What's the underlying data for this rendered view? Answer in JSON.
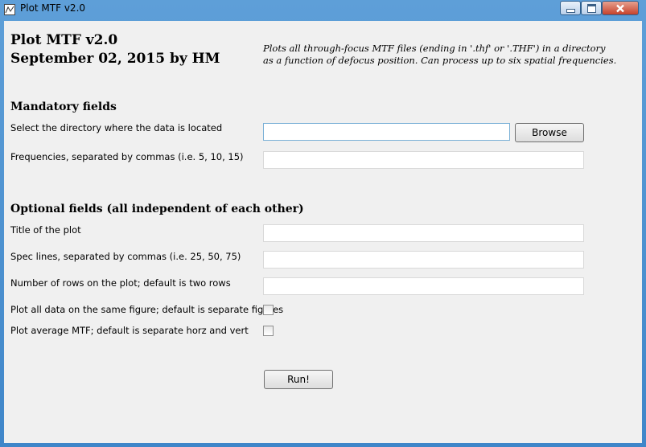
{
  "window": {
    "title": "Plot MTF v2.0"
  },
  "header": {
    "title_line1": "Plot MTF v2.0",
    "title_line2": "September 02, 2015 by HM",
    "desc_line1": "Plots all through-focus MTF files (ending in '.thf' or '.THF') in a directory",
    "desc_line2": "as a function of defocus position.  Can process up to six spatial frequencies."
  },
  "mandatory": {
    "heading": "Mandatory fields",
    "directory_label": "Select the directory where the data is located",
    "directory_value": "",
    "browse_label": "Browse",
    "frequencies_label": "Frequencies, separated by commas (i.e. 5, 10, 15)",
    "frequencies_value": ""
  },
  "optional": {
    "heading": "Optional fields (all independent of each other)",
    "plot_title_label": "Title of the plot",
    "plot_title_value": "",
    "spec_lines_label": "Spec lines, separated by commas (i.e. 25, 50, 75)",
    "spec_lines_value": "",
    "rows_label": "Number of rows on the plot; default is two rows",
    "rows_value": "",
    "same_figure_label": "Plot all data on the same figure; default is separate figures",
    "same_figure_checked": false,
    "average_label": "Plot average MTF; default is separate horz and vert",
    "average_checked": false
  },
  "run_label": "Run!"
}
